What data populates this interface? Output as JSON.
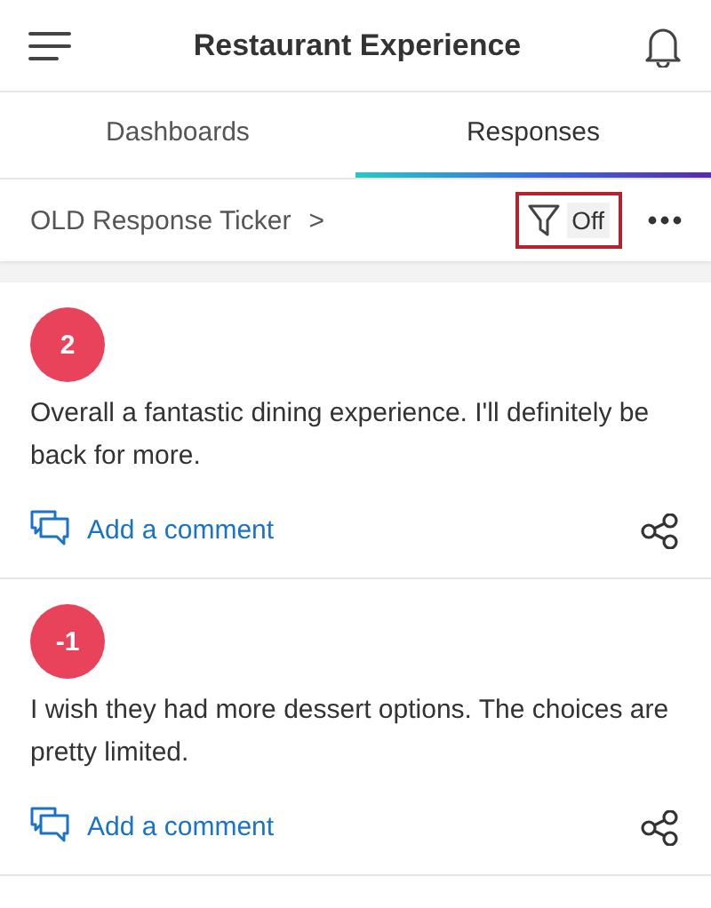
{
  "header": {
    "title": "Restaurant Experience"
  },
  "tabs": [
    {
      "label": "Dashboards",
      "selected": false
    },
    {
      "label": "Responses",
      "selected": true
    }
  ],
  "ticker": {
    "title": "OLD Response Ticker",
    "chevron": ">",
    "filter": {
      "label": "Off",
      "highlighted": true
    }
  },
  "responses": [
    {
      "score": "2",
      "text": "Overall a fantastic dining experience. I'll definitely be back for more.",
      "comment_link": "Add a comment"
    },
    {
      "score": "-1",
      "text": "I wish they had more dessert options. The choices are pretty limited.",
      "comment_link": "Add a comment"
    }
  ]
}
